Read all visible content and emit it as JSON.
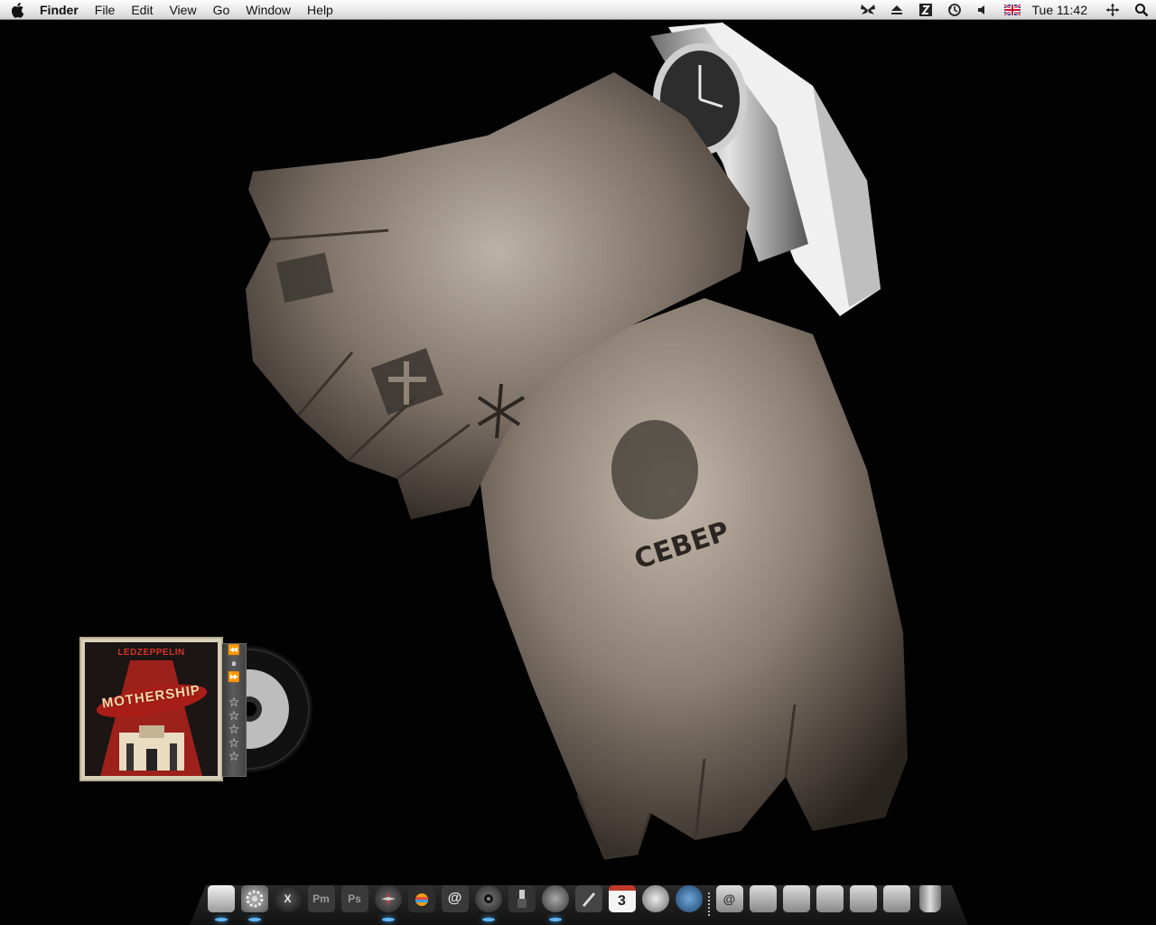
{
  "menubar": {
    "apple_icon": "apple-logo-icon",
    "app_name": "Finder",
    "menus": [
      "File",
      "Edit",
      "View",
      "Go",
      "Window",
      "Help"
    ],
    "status_icons": [
      "butterfly-icon",
      "eject-icon",
      "sidebar-icon",
      "time-machine-icon",
      "volume-icon",
      "uk-flag-icon"
    ],
    "clock": "Tue 11:42",
    "extra_icons": [
      "spaces-icon",
      "spotlight-icon"
    ]
  },
  "widget": {
    "album_band": "LEDZEPPELIN",
    "album_title": "MOTHERSHIP",
    "controls": {
      "previous": "⏪",
      "pause": "⏸",
      "next": "⏩"
    },
    "rating_stars": 5,
    "star_glyph": "☆"
  },
  "dock": {
    "apps": [
      {
        "name": "finder-icon",
        "label": "",
        "color": "#d8d8d8",
        "running": true
      },
      {
        "name": "system-preferences-icon",
        "label": "",
        "color": "#8a8a8a",
        "running": true
      },
      {
        "name": "x-app-icon",
        "label": "X",
        "color": "#2c2c2c",
        "running": false
      },
      {
        "name": "pm-app-icon",
        "label": "Pm",
        "color": "#3a3a3a",
        "running": false
      },
      {
        "name": "photoshop-icon",
        "label": "Ps",
        "color": "#3a3a3a",
        "running": false
      },
      {
        "name": "safari-icon",
        "label": "",
        "color": "#3b3b3b",
        "running": true
      },
      {
        "name": "iphoto-icon",
        "label": "",
        "color": "#2d2d2d",
        "running": false
      },
      {
        "name": "mail-icon",
        "label": "@",
        "color": "#3a3a3a",
        "running": false
      },
      {
        "name": "itunes-icon",
        "label": "",
        "color": "#4a4a4a",
        "running": true
      },
      {
        "name": "utility-icon",
        "label": "",
        "color": "#333333",
        "running": false
      },
      {
        "name": "speaker-icon",
        "label": "",
        "color": "#555555",
        "running": true
      },
      {
        "name": "pen-tool-icon",
        "label": "",
        "color": "#444444",
        "running": false
      },
      {
        "name": "ical-icon",
        "label": "3",
        "color": "#f4f4f4",
        "running": false
      },
      {
        "name": "google-earth-icon",
        "label": "",
        "color": "#9a9a9a",
        "running": false
      },
      {
        "name": "globe-icon",
        "label": "",
        "color": "#2f5e8f",
        "running": false
      }
    ],
    "folders": [
      {
        "name": "mail-folder-icon",
        "label": "@"
      },
      {
        "name": "documents-folder-icon",
        "label": ""
      },
      {
        "name": "applications-folder-icon",
        "label": ""
      },
      {
        "name": "utilities-folder-icon",
        "label": ""
      },
      {
        "name": "library-folder-icon",
        "label": ""
      },
      {
        "name": "downloads-folder-icon",
        "label": ""
      },
      {
        "name": "trash-icon",
        "label": ""
      }
    ]
  }
}
